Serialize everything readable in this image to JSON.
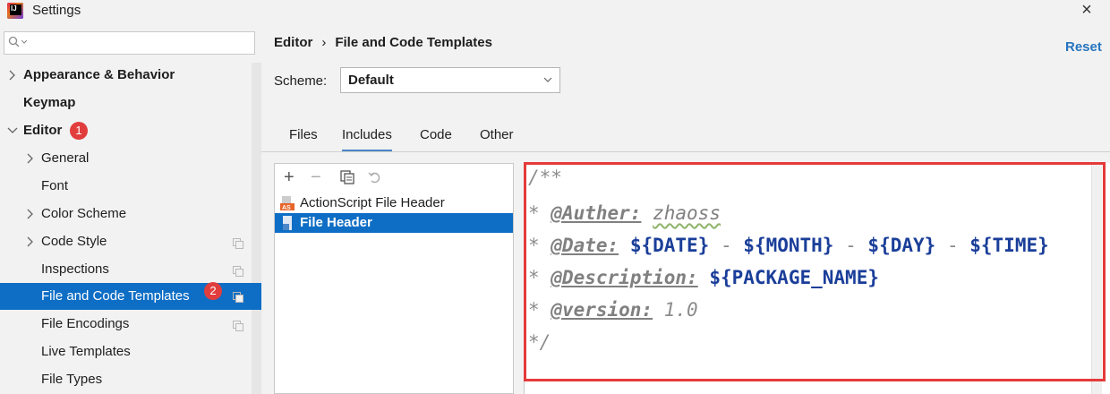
{
  "window": {
    "title": "Settings",
    "close_symbol": "×"
  },
  "sidebar": {
    "search_placeholder": "",
    "items": [
      {
        "label": "Appearance & Behavior"
      },
      {
        "label": "Keymap"
      },
      {
        "label": "Editor",
        "badge": "1"
      },
      {
        "label": "General"
      },
      {
        "label": "Font"
      },
      {
        "label": "Color Scheme"
      },
      {
        "label": "Code Style"
      },
      {
        "label": "Inspections"
      },
      {
        "label": "File and Code Templates",
        "badge": "2"
      },
      {
        "label": "File Encodings"
      },
      {
        "label": "Live Templates"
      },
      {
        "label": "File Types"
      }
    ]
  },
  "header": {
    "breadcrumb_root": "Editor",
    "breadcrumb_sep": "›",
    "breadcrumb_current": "File and Code Templates",
    "reset_label": "Reset"
  },
  "scheme": {
    "label": "Scheme:",
    "value": "Default"
  },
  "tabs": [
    {
      "label": "Files"
    },
    {
      "label": "Includes",
      "active": true
    },
    {
      "label": "Code"
    },
    {
      "label": "Other"
    }
  ],
  "toolbar": {
    "add": "+",
    "remove": "−",
    "copy": "⧉",
    "reset": "↶"
  },
  "templates": [
    {
      "label": "ActionScript File Header",
      "icon_text": "AS"
    },
    {
      "label": "File Header",
      "selected": true
    }
  ],
  "code": {
    "line1": "/**",
    "line2_star": "* ",
    "line2_tag": "@Auther:",
    "line2_value": "zhaoss",
    "line3_star": "* ",
    "line3_tag": "@Date:",
    "line3_v1": "${DATE}",
    "line3_v2": "${MONTH}",
    "line3_v3": "${DAY}",
    "line3_v4": "${TIME}",
    "line3_dash": "-",
    "line4_star": "* ",
    "line4_tag": "@Description:",
    "line4_value": "${PACKAGE_NAME}",
    "line5_star": "* ",
    "line5_tag": "@version:",
    "line5_value": "1.0",
    "line6": "*/"
  },
  "colors": {
    "accent": "#0e6ec5",
    "badge": "#e23d3d",
    "highlight_box": "#e53a3a",
    "link": "#2675bf"
  }
}
